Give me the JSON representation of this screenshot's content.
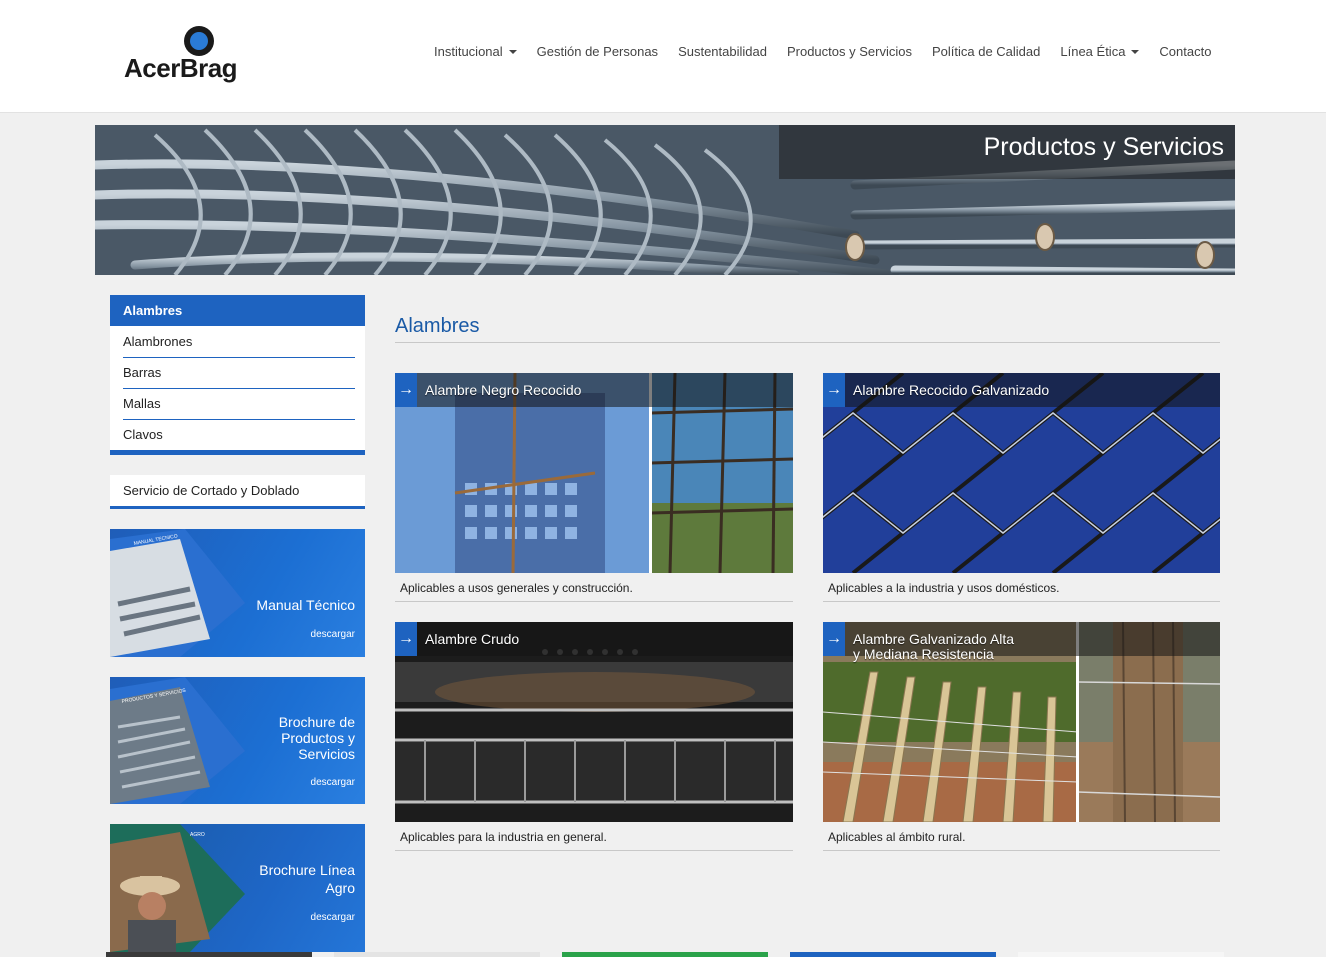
{
  "header": {
    "logo_text": "AcerBrag",
    "nav": [
      {
        "label": "Institucional",
        "dropdown": true
      },
      {
        "label": "Gestión de Personas",
        "dropdown": false
      },
      {
        "label": "Sustentabilidad",
        "dropdown": false
      },
      {
        "label": "Productos y Servicios",
        "dropdown": false
      },
      {
        "label": "Política de Calidad",
        "dropdown": false
      },
      {
        "label": "Línea Ética",
        "dropdown": true
      },
      {
        "label": "Contacto",
        "dropdown": false
      }
    ]
  },
  "banner": {
    "title": "Productos y Servicios"
  },
  "sidebar": {
    "items": [
      {
        "label": "Alambres",
        "active": true
      },
      {
        "label": "Alambrones",
        "active": false
      },
      {
        "label": "Barras",
        "active": false
      },
      {
        "label": "Mallas",
        "active": false
      },
      {
        "label": "Clavos",
        "active": false
      }
    ],
    "service": "Servicio de Cortado y Doblado",
    "promos": [
      {
        "title": "Manual Técnico",
        "link": "descargar",
        "book_label": "MANUAL TECNICO"
      },
      {
        "title": "Brochure de Productos y Servicios",
        "link": "descargar",
        "book_label": "PRODUCTOS Y SERVICIOS"
      },
      {
        "title": "Brochure Línea Agro",
        "link": "descargar",
        "book_label": "AGRO"
      }
    ]
  },
  "main": {
    "title": "Alambres",
    "products": [
      {
        "title": "Alambre Negro Recocido",
        "desc": "Aplicables a usos generales y construcción."
      },
      {
        "title": "Alambre Recocido Galvanizado",
        "desc": "Aplicables a la industria y usos domésticos."
      },
      {
        "title": "Alambre Crudo",
        "desc": "Aplicables para la industria en general."
      },
      {
        "title_line1": "Alambre Galvanizado Alta",
        "title_line2": "y Mediana Resistencia",
        "desc": "Aplicables al ámbito rural."
      }
    ]
  },
  "colors": {
    "accent": "#1e63c0",
    "title_blue": "#1a5aa6"
  }
}
